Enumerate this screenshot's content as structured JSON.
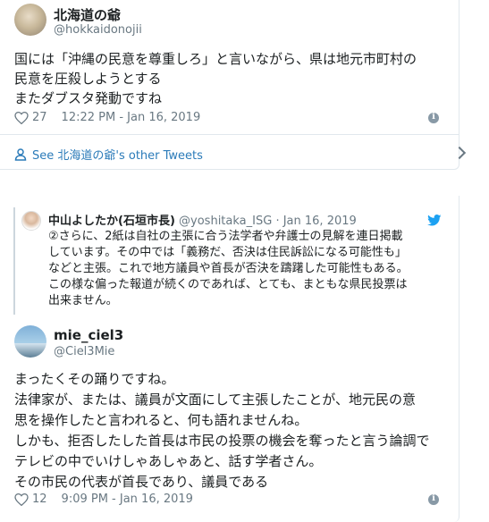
{
  "tweet1": {
    "name": "北海道の爺",
    "handle": "@hokkaidonojii",
    "lines": [
      "国には「沖縄の民意を尊重しろ」と言いながら、県は地元市町村の",
      "民意を圧殺しようとする",
      "またダブスタ発動ですね"
    ],
    "likes": "27",
    "time": "12:22 PM - Jan 16, 2019",
    "see_more": "See 北海道の爺's other Tweets"
  },
  "quoted": {
    "name": "中山よしたか(石垣市長)",
    "handle": "@yoshitaka_ISG",
    "sep": "·",
    "date": "Jan 16, 2019",
    "lines": [
      "②さらに、2紙は自社の主張に合う法学者や弁護士の見解を連日掲載",
      "しています。その中では「義務だ、否決は住民訴訟になる可能性も」",
      "などと主張。これで地方議員や首長が否決を躊躇した可能性もある。",
      "この様な偏った報道が続くのであれば、とても、まともな県民投票は",
      "出来ません。"
    ]
  },
  "tweet2": {
    "name": "mie_ciel3",
    "handle": "@Ciel3Mie",
    "lines": [
      "まったくその踊りですね。",
      "法律家が、または、議員が文面にして主張したことが、地元民の意",
      "思を操作したと言われると、何も語れませんね。",
      "しかも、拒否したした首長は市民の投票の機会を奪ったと言う論調で",
      "テレビの中でいけしゃあしゃあと、話す学者さん。",
      "その市民の代表が首長であり、議員である"
    ],
    "likes": "12",
    "time": "9:09 PM - Jan 16, 2019"
  },
  "colors": {
    "link": "#2b7bb9",
    "muted": "#697882",
    "twitter_blue": "#1da1f2",
    "border": "#e1e8ed"
  },
  "icons": [
    "heart-icon",
    "info-icon",
    "person-icon",
    "chevron-right-icon",
    "twitter-bird-icon"
  ]
}
